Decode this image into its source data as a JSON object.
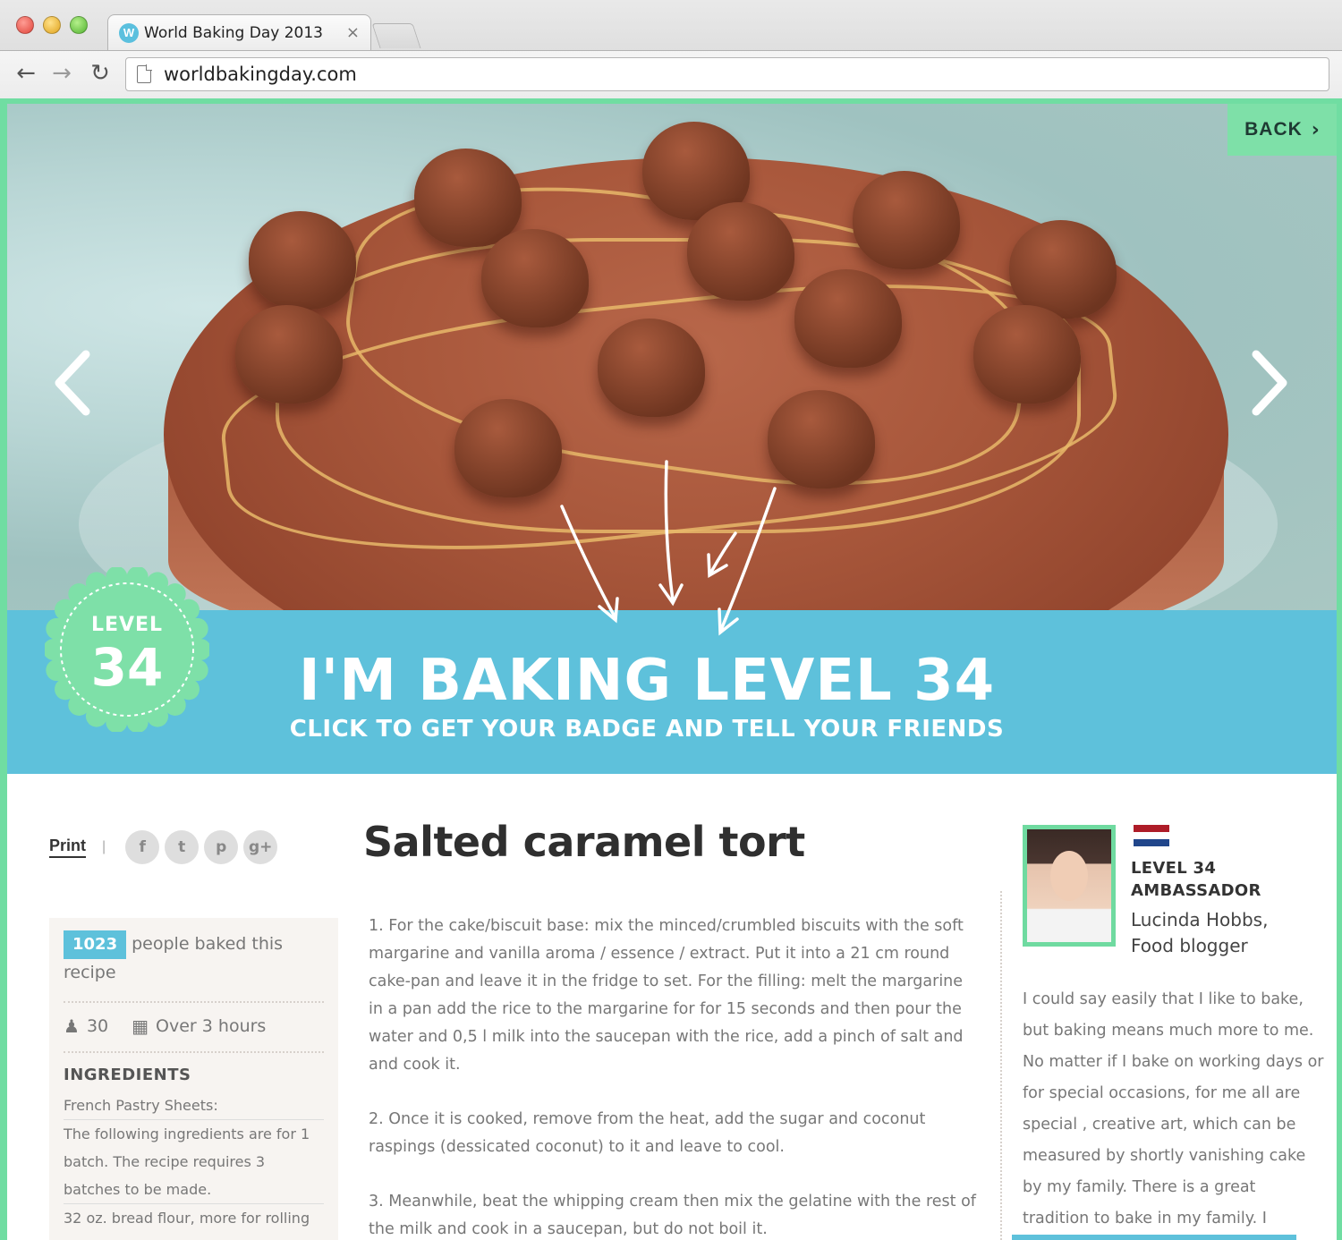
{
  "browser": {
    "tab_title": "World Baking Day 2013",
    "tab_favicon": "W",
    "tab_close": "×",
    "url": "worldbakingday.com",
    "nav": {
      "back": "←",
      "forward": "→",
      "reload": "↻"
    }
  },
  "hero": {
    "back_label": "BACK",
    "back_chevron": "›",
    "image_alt_icon": "cake-photo"
  },
  "badge": {
    "label": "LEVEL",
    "number": "34"
  },
  "banner": {
    "title": "I'M BAKING LEVEL 34",
    "subtitle": "CLICK TO GET YOUR BADGE AND TELL YOUR FRIENDS"
  },
  "share": {
    "print_label": "Print",
    "separator": "|",
    "icons": [
      {
        "name": "facebook-icon",
        "glyph": "f"
      },
      {
        "name": "twitter-icon",
        "glyph": "t"
      },
      {
        "name": "pinterest-icon",
        "glyph": "p"
      },
      {
        "name": "googleplus-icon",
        "glyph": "g+"
      }
    ]
  },
  "sidebar": {
    "baked_count": "1023",
    "baked_text": "people baked this recipe",
    "servings": "30",
    "time": "Over 3 hours",
    "ingredients_title": "INGREDIENTS",
    "ingredients": [
      "French Pastry Sheets:",
      "The following ingredients are for 1 batch. The recipe requires 3 batches to be made.",
      "32 oz. bread flour, more for rolling"
    ]
  },
  "recipe": {
    "title": "Salted caramel tort",
    "steps": [
      "1. For the cake/biscuit base: mix the minced/crumbled biscuits with the soft margarine and vanilla aroma / essence / extract. Put it into a 21 cm round cake-pan and leave it in the fridge to set. For the filling: melt the margarine in a pan add the rice to the margarine for for 15 seconds and then pour the water and 0,5 l milk into the saucepan with the rice, add a pinch of salt and and cook it.",
      "2. Once it is cooked, remove from the heat, add the sugar and coconut raspings (dessicated coconut) to it and leave to cool.",
      "3. Meanwhile, beat the whipping cream then mix the gelatine with the rest of the milk and cook in a saucepan, but do not boil it."
    ]
  },
  "author": {
    "rank_line1": "LEVEL 34",
    "rank_line2": "AMBASSADOR",
    "name": "Lucinda Hobbs,",
    "role": "Food blogger",
    "flag_colors": [
      "#ae1c28",
      "#ffffff",
      "#21468b"
    ],
    "bio": "I could say easily that I like to bake, but baking means much more to me. No matter if I bake on working days or for special occasions, for me all are special , creative art, which can be measured by shortly vanishing cake by my family. There is a great tradition to bake in my family. I"
  },
  "colors": {
    "mint": "#70dda2",
    "banner_blue": "#5ec1db",
    "badge_green": "#7ee0a8"
  }
}
